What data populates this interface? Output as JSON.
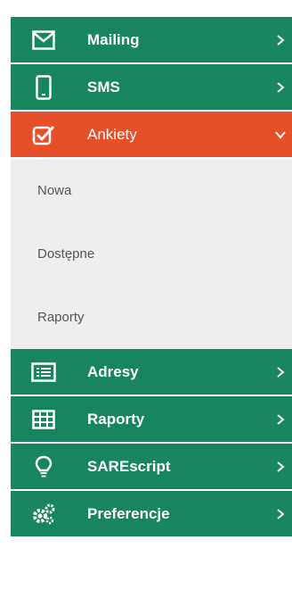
{
  "menu": {
    "items": [
      {
        "label": "Mailing",
        "icon": "envelope-icon"
      },
      {
        "label": "SMS",
        "icon": "mobile-phone-icon"
      },
      {
        "label": "Ankiety",
        "icon": "checkbox-icon",
        "active": true
      },
      {
        "label": "Adresy",
        "icon": "address-list-icon"
      },
      {
        "label": "Raporty",
        "icon": "table-grid-icon"
      },
      {
        "label": "SAREscript",
        "icon": "lightbulb-icon"
      },
      {
        "label": "Preferencje",
        "icon": "gears-icon"
      }
    ],
    "submenu": [
      {
        "label": "Nowa"
      },
      {
        "label": "Dostępne"
      },
      {
        "label": "Raporty"
      }
    ]
  },
  "colors": {
    "green": "#17865e",
    "active": "#e64f28",
    "submenu_bg": "#f0eeec"
  }
}
